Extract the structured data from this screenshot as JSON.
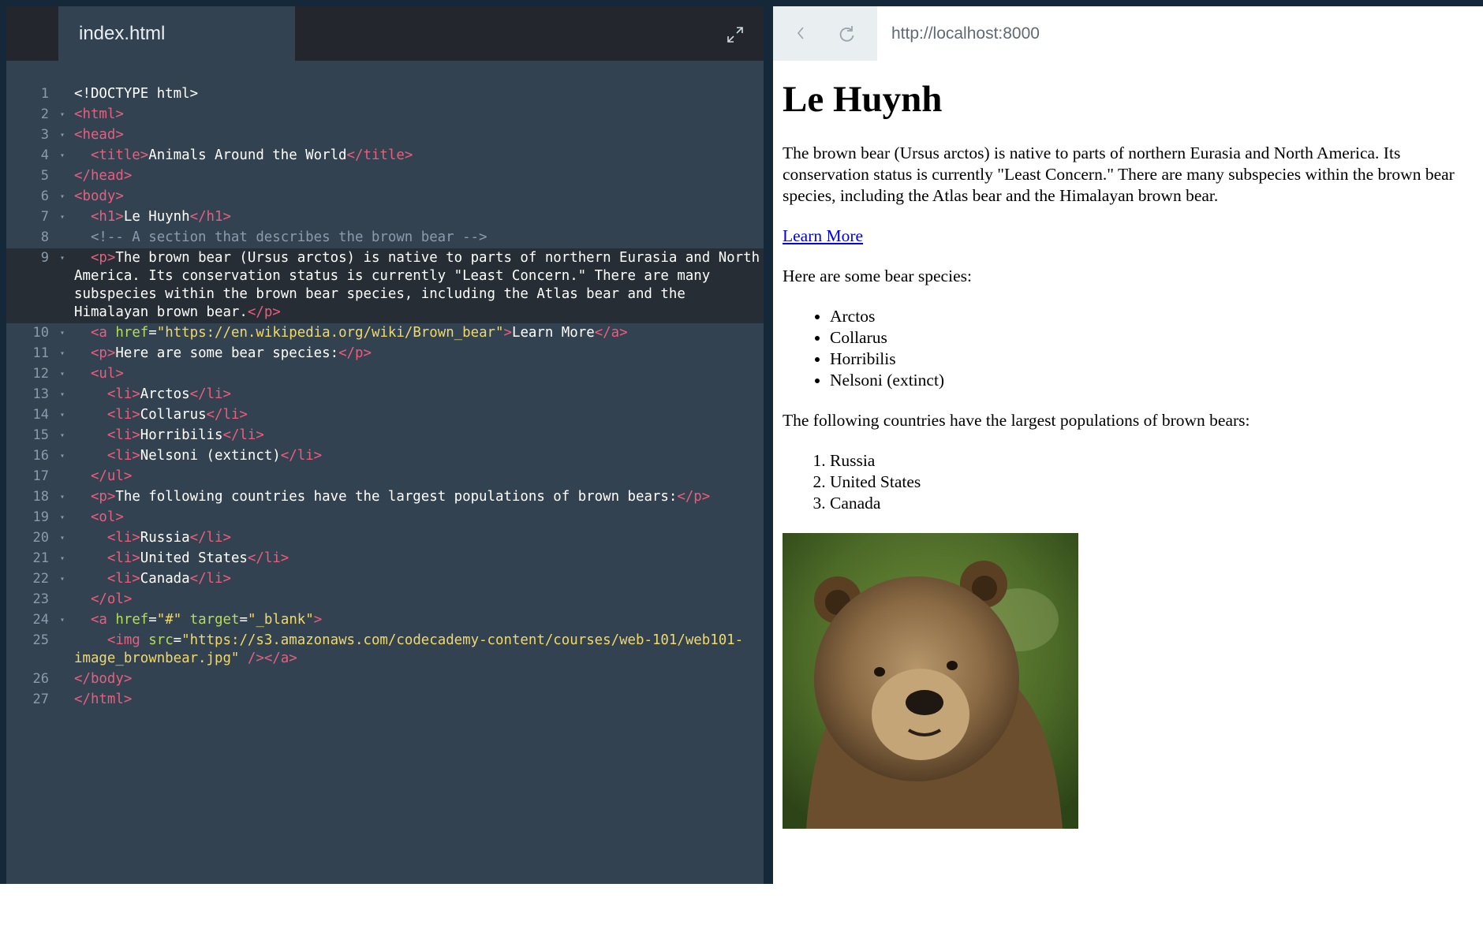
{
  "editor": {
    "tab_label": "index.html",
    "lines": [
      {
        "n": "1",
        "fold": false,
        "hl": false,
        "wrap": false,
        "segs": [
          [
            "t",
            ""
          ],
          [
            "w",
            "<!DOCTYPE html>"
          ]
        ]
      },
      {
        "n": "2",
        "fold": true,
        "hl": false,
        "wrap": false,
        "segs": [
          [
            "t",
            "<html>"
          ]
        ]
      },
      {
        "n": "3",
        "fold": true,
        "hl": false,
        "wrap": false,
        "segs": [
          [
            "t",
            "<head>"
          ]
        ]
      },
      {
        "n": "4",
        "fold": true,
        "hl": false,
        "wrap": false,
        "segs": [
          [
            "w",
            "  "
          ],
          [
            "t",
            "<title>"
          ],
          [
            "w",
            "Animals Around the World"
          ],
          [
            "t",
            "</title>"
          ]
        ]
      },
      {
        "n": "5",
        "fold": false,
        "hl": false,
        "wrap": false,
        "segs": [
          [
            "t",
            "</head>"
          ]
        ]
      },
      {
        "n": "6",
        "fold": true,
        "hl": false,
        "wrap": false,
        "segs": [
          [
            "t",
            "<body>"
          ]
        ]
      },
      {
        "n": "7",
        "fold": true,
        "hl": false,
        "wrap": false,
        "segs": [
          [
            "w",
            "  "
          ],
          [
            "t",
            "<h1>"
          ],
          [
            "w",
            "Le Huynh"
          ],
          [
            "t",
            "</h1>"
          ]
        ]
      },
      {
        "n": "8",
        "fold": false,
        "hl": false,
        "wrap": false,
        "segs": [
          [
            "cm",
            "  <!-- A section that describes the brown bear -->"
          ]
        ]
      },
      {
        "n": "9",
        "fold": true,
        "hl": true,
        "wrap": true,
        "segs": [
          [
            "w",
            "  "
          ],
          [
            "t",
            "<p>"
          ],
          [
            "w",
            "The brown bear (Ursus arctos) is native to parts of northern Eurasia and North America. Its conservation status is currently \"Least Concern.\" There are many subspecies within the brown bear species, including the Atlas bear and the Himalayan brown bear."
          ],
          [
            "t",
            "</p>"
          ]
        ]
      },
      {
        "n": "10",
        "fold": true,
        "hl": false,
        "wrap": false,
        "segs": [
          [
            "w",
            "  "
          ],
          [
            "t",
            "<a "
          ],
          [
            "at",
            "href"
          ],
          [
            "w",
            "="
          ],
          [
            "s",
            "\"https://en.wikipedia.org/wiki/Brown_bear\""
          ],
          [
            "t",
            ">"
          ],
          [
            "w",
            "Learn More"
          ],
          [
            "t",
            "</a>"
          ]
        ]
      },
      {
        "n": "11",
        "fold": true,
        "hl": false,
        "wrap": false,
        "segs": [
          [
            "w",
            "  "
          ],
          [
            "t",
            "<p>"
          ],
          [
            "w",
            "Here are some bear species:"
          ],
          [
            "t",
            "</p>"
          ]
        ]
      },
      {
        "n": "12",
        "fold": true,
        "hl": false,
        "wrap": false,
        "segs": [
          [
            "w",
            "  "
          ],
          [
            "t",
            "<ul>"
          ]
        ]
      },
      {
        "n": "13",
        "fold": true,
        "hl": false,
        "wrap": false,
        "segs": [
          [
            "w",
            "    "
          ],
          [
            "t",
            "<li>"
          ],
          [
            "w",
            "Arctos"
          ],
          [
            "t",
            "</li>"
          ]
        ]
      },
      {
        "n": "14",
        "fold": true,
        "hl": false,
        "wrap": false,
        "segs": [
          [
            "w",
            "    "
          ],
          [
            "t",
            "<li>"
          ],
          [
            "w",
            "Collarus"
          ],
          [
            "t",
            "</li>"
          ]
        ]
      },
      {
        "n": "15",
        "fold": true,
        "hl": false,
        "wrap": false,
        "segs": [
          [
            "w",
            "    "
          ],
          [
            "t",
            "<li>"
          ],
          [
            "w",
            "Horribilis"
          ],
          [
            "t",
            "</li>"
          ]
        ]
      },
      {
        "n": "16",
        "fold": true,
        "hl": false,
        "wrap": false,
        "segs": [
          [
            "w",
            "    "
          ],
          [
            "t",
            "<li>"
          ],
          [
            "w",
            "Nelsoni (extinct)"
          ],
          [
            "t",
            "</li>"
          ]
        ]
      },
      {
        "n": "17",
        "fold": false,
        "hl": false,
        "wrap": false,
        "segs": [
          [
            "w",
            "  "
          ],
          [
            "t",
            "</ul>"
          ]
        ]
      },
      {
        "n": "18",
        "fold": true,
        "hl": false,
        "wrap": false,
        "segs": [
          [
            "w",
            "  "
          ],
          [
            "t",
            "<p>"
          ],
          [
            "w",
            "The following countries have the largest populations of brown bears:"
          ],
          [
            "t",
            "</p>"
          ]
        ]
      },
      {
        "n": "19",
        "fold": true,
        "hl": false,
        "wrap": false,
        "segs": [
          [
            "w",
            "  "
          ],
          [
            "t",
            "<ol>"
          ]
        ]
      },
      {
        "n": "20",
        "fold": true,
        "hl": false,
        "wrap": false,
        "segs": [
          [
            "w",
            "    "
          ],
          [
            "t",
            "<li>"
          ],
          [
            "w",
            "Russia"
          ],
          [
            "t",
            "</li>"
          ]
        ]
      },
      {
        "n": "21",
        "fold": true,
        "hl": false,
        "wrap": false,
        "segs": [
          [
            "w",
            "    "
          ],
          [
            "t",
            "<li>"
          ],
          [
            "w",
            "United States"
          ],
          [
            "t",
            "</li>"
          ]
        ]
      },
      {
        "n": "22",
        "fold": true,
        "hl": false,
        "wrap": false,
        "segs": [
          [
            "w",
            "    "
          ],
          [
            "t",
            "<li>"
          ],
          [
            "w",
            "Canada"
          ],
          [
            "t",
            "</li>"
          ]
        ]
      },
      {
        "n": "23",
        "fold": false,
        "hl": false,
        "wrap": false,
        "segs": [
          [
            "w",
            "  "
          ],
          [
            "t",
            "</ol>"
          ]
        ]
      },
      {
        "n": "24",
        "fold": true,
        "hl": false,
        "wrap": false,
        "segs": [
          [
            "w",
            "  "
          ],
          [
            "t",
            "<a "
          ],
          [
            "at",
            "href"
          ],
          [
            "w",
            "="
          ],
          [
            "s",
            "\"#\""
          ],
          [
            "w",
            " "
          ],
          [
            "at",
            "target"
          ],
          [
            "w",
            "="
          ],
          [
            "s",
            "\"_blank\""
          ],
          [
            "t",
            ">"
          ]
        ]
      },
      {
        "n": "25",
        "fold": false,
        "hl": false,
        "wrap": true,
        "segs": [
          [
            "w",
            "    "
          ],
          [
            "t",
            "<img "
          ],
          [
            "at",
            "src"
          ],
          [
            "w",
            "="
          ],
          [
            "s",
            "\"https://s3.amazonaws.com/codecademy-content/courses/web-101/web101-image_brownbear.jpg\""
          ],
          [
            "w",
            " "
          ],
          [
            "t",
            "/></a>"
          ]
        ]
      },
      {
        "n": "26",
        "fold": false,
        "hl": false,
        "wrap": false,
        "segs": [
          [
            "t",
            "</body>"
          ]
        ]
      },
      {
        "n": "27",
        "fold": false,
        "hl": false,
        "wrap": false,
        "segs": [
          [
            "t",
            "</html>"
          ]
        ]
      }
    ]
  },
  "browser": {
    "url": "http://localhost:8000",
    "page": {
      "heading": "Le Huynh",
      "intro": "The brown bear (Ursus arctos) is native to parts of northern Eurasia and North America. Its conservation status is currently \"Least Concern.\" There are many subspecies within the brown bear species, including the Atlas bear and the Himalayan brown bear.",
      "link_label": "Learn More",
      "species_intro": "Here are some bear species:",
      "species": [
        "Arctos",
        "Collarus",
        "Horribilis",
        "Nelsoni (extinct)"
      ],
      "countries_intro": "The following countries have the largest populations of brown bears:",
      "countries": [
        "Russia",
        "United States",
        "Canada"
      ]
    }
  },
  "colors": {
    "editor_bg": "#334251",
    "tag": "#e85f7e",
    "attr": "#b7db5b",
    "string": "#f0d96c",
    "comment": "#8c9bab",
    "link": "#0000ee"
  },
  "icons": {
    "expand": "expand-icon",
    "back": "back-arrow-icon",
    "reload": "reload-icon"
  }
}
